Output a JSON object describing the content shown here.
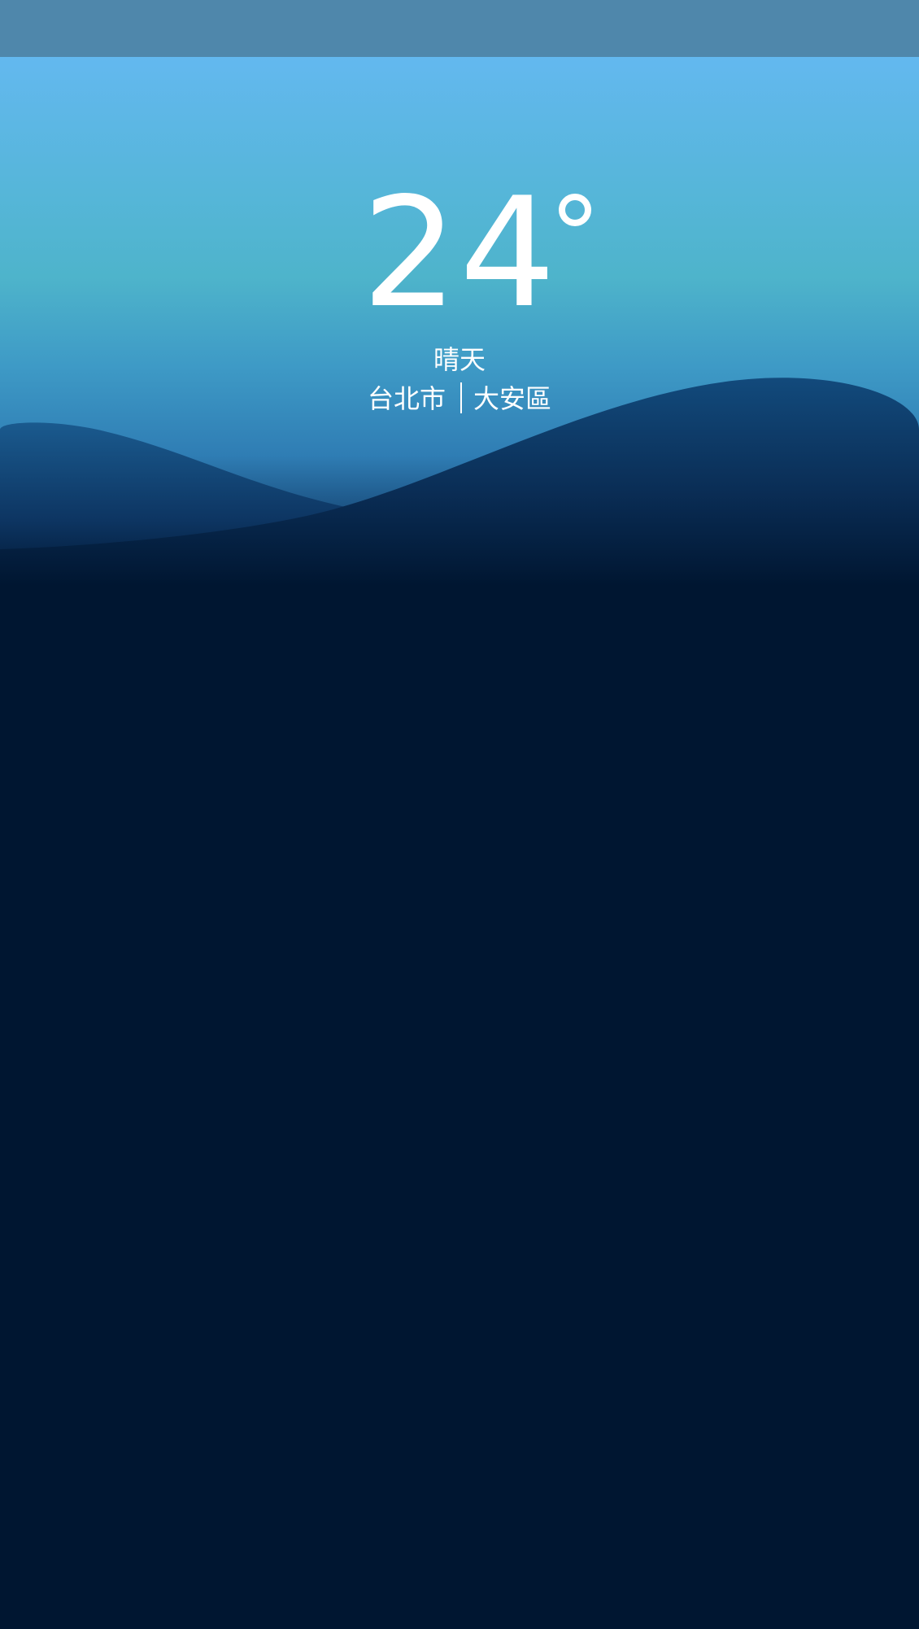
{
  "weather": {
    "temperature": "24",
    "condition": "晴天",
    "city": "台北市",
    "district": "大安區"
  },
  "icons": {
    "degree": "degree-icon"
  },
  "colors": {
    "status_bar": "#4f87ab",
    "sky_top": "#63b8ef",
    "sky_mid": "#4eb4cb",
    "hill_dark": "#0e3a66",
    "background": "#001631",
    "text": "#ffffff"
  }
}
